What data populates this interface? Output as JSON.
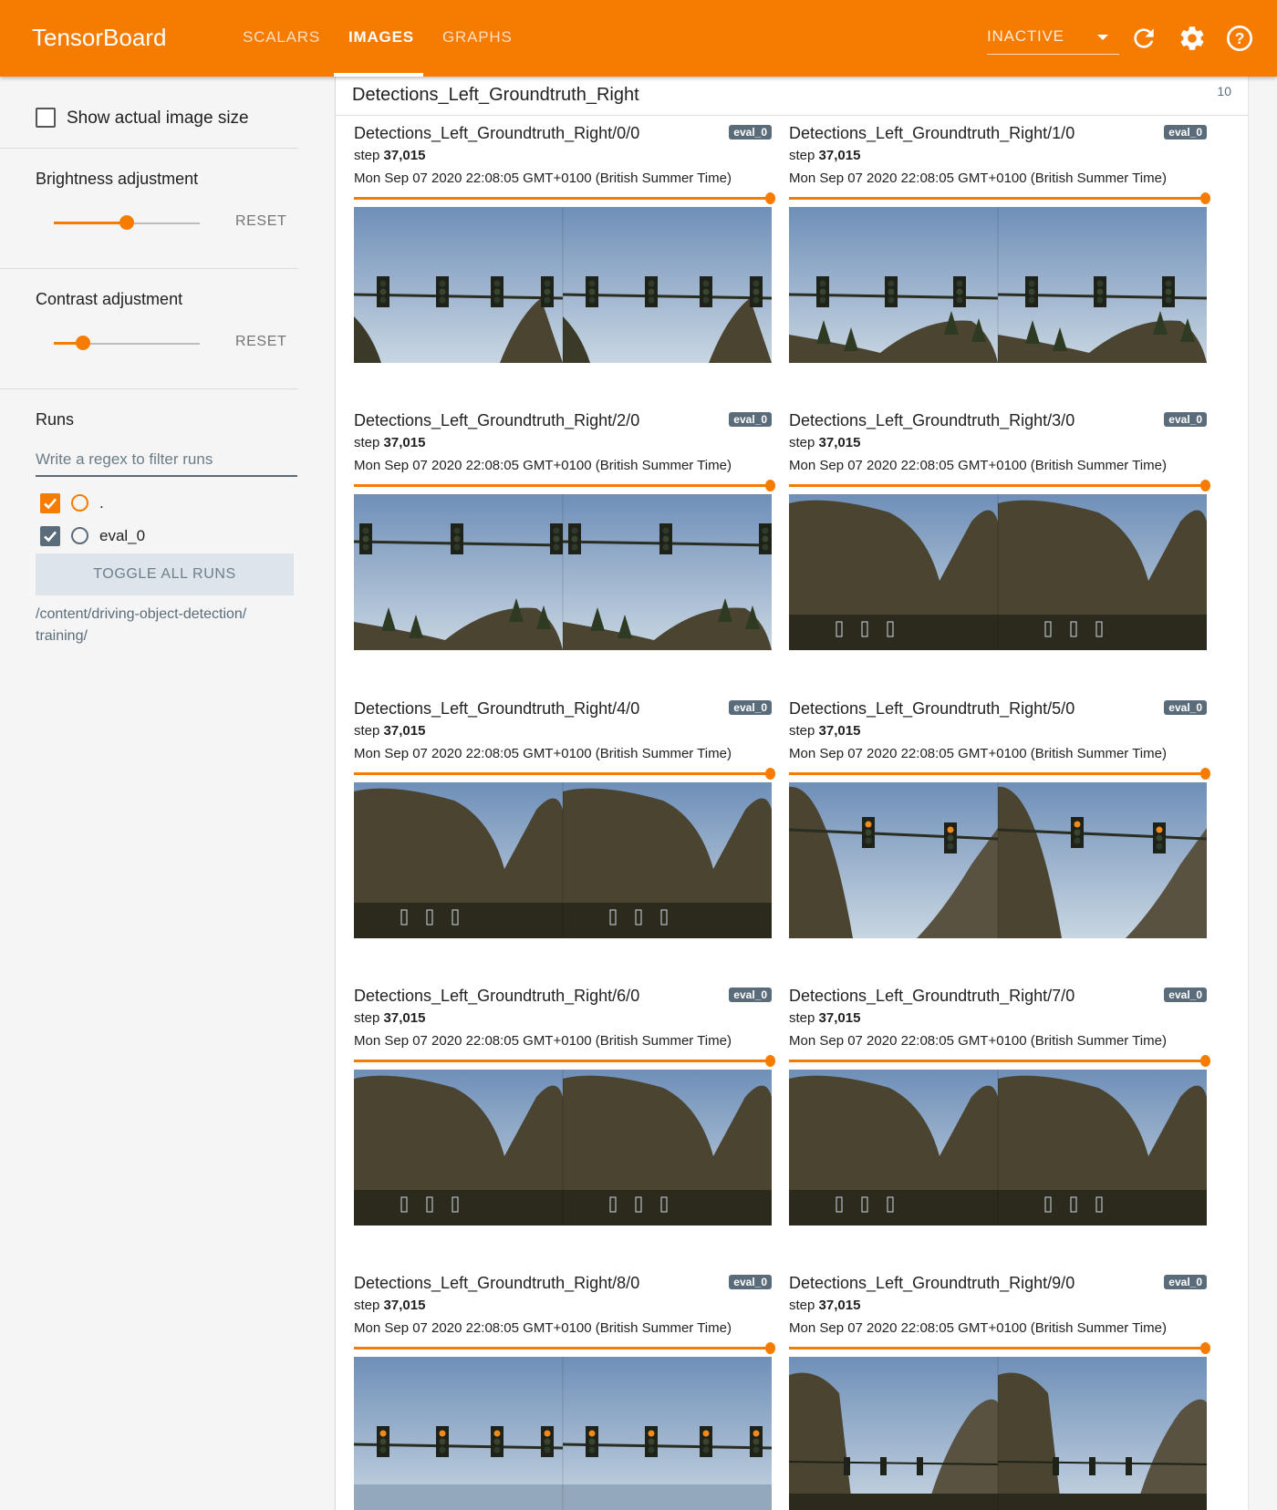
{
  "header": {
    "brand": "TensorBoard",
    "tabs": [
      {
        "label": "SCALARS",
        "active": false
      },
      {
        "label": "IMAGES",
        "active": true
      },
      {
        "label": "GRAPHS",
        "active": false
      }
    ],
    "status_select": "INACTIVE",
    "icons": [
      "refresh-icon",
      "settings-gear-icon",
      "help-circle-icon"
    ]
  },
  "sidebar": {
    "show_actual_size_label": "Show actual image size",
    "show_actual_size_checked": false,
    "brightness": {
      "label": "Brightness adjustment",
      "reset": "RESET",
      "value": 0.5
    },
    "contrast": {
      "label": "Contrast adjustment",
      "reset": "RESET",
      "value": 0.2
    },
    "runs_title": "Runs",
    "regex_placeholder": "Write a regex to filter runs",
    "runs": [
      {
        "name": ".",
        "checked": true,
        "color": "#f57c00"
      },
      {
        "name": "eval_0",
        "checked": true,
        "color": "#5a6c7a"
      }
    ],
    "toggle_all": "TOGGLE ALL RUNS",
    "logdir_line1": "/content/driving-object-detection/",
    "logdir_line2": "training/"
  },
  "main": {
    "tag": "Detections_Left_Groundtruth_Right",
    "count": "10",
    "items": [
      {
        "title": "Detections_Left_Groundtruth_Right/0/0",
        "run": "eval_0",
        "step_label": "step",
        "step": "37,015",
        "time": "Mon Sep 07 2020 22:08:05 GMT+0100 (British Summer Time)"
      },
      {
        "title": "Detections_Left_Groundtruth_Right/1/0",
        "run": "eval_0",
        "step_label": "step",
        "step": "37,015",
        "time": "Mon Sep 07 2020 22:08:05 GMT+0100 (British Summer Time)"
      },
      {
        "title": "Detections_Left_Groundtruth_Right/2/0",
        "run": "eval_0",
        "step_label": "step",
        "step": "37,015",
        "time": "Mon Sep 07 2020 22:08:05 GMT+0100 (British Summer Time)"
      },
      {
        "title": "Detections_Left_Groundtruth_Right/3/0",
        "run": "eval_0",
        "step_label": "step",
        "step": "37,015",
        "time": "Mon Sep 07 2020 22:08:05 GMT+0100 (British Summer Time)"
      },
      {
        "title": "Detections_Left_Groundtruth_Right/4/0",
        "run": "eval_0",
        "step_label": "step",
        "step": "37,015",
        "time": "Mon Sep 07 2020 22:08:05 GMT+0100 (British Summer Time)"
      },
      {
        "title": "Detections_Left_Groundtruth_Right/5/0",
        "run": "eval_0",
        "step_label": "step",
        "step": "37,015",
        "time": "Mon Sep 07 2020 22:08:05 GMT+0100 (British Summer Time)"
      },
      {
        "title": "Detections_Left_Groundtruth_Right/6/0",
        "run": "eval_0",
        "step_label": "step",
        "step": "37,015",
        "time": "Mon Sep 07 2020 22:08:05 GMT+0100 (British Summer Time)"
      },
      {
        "title": "Detections_Left_Groundtruth_Right/7/0",
        "run": "eval_0",
        "step_label": "step",
        "step": "37,015",
        "time": "Mon Sep 07 2020 22:08:05 GMT+0100 (British Summer Time)"
      },
      {
        "title": "Detections_Left_Groundtruth_Right/8/0",
        "run": "eval_0",
        "step_label": "step",
        "step": "37,015",
        "time": "Mon Sep 07 2020 22:08:05 GMT+0100 (British Summer Time)"
      },
      {
        "title": "Detections_Left_Groundtruth_Right/9/0",
        "run": "eval_0",
        "step_label": "step",
        "step": "37,015",
        "time": "Mon Sep 07 2020 22:08:05 GMT+0100 (British Summer Time)"
      }
    ]
  },
  "colors": {
    "accent": "#f57c00",
    "run_badge": "#5a6c7a",
    "sky": "#7d9cc0",
    "rock": "#4a4431"
  }
}
